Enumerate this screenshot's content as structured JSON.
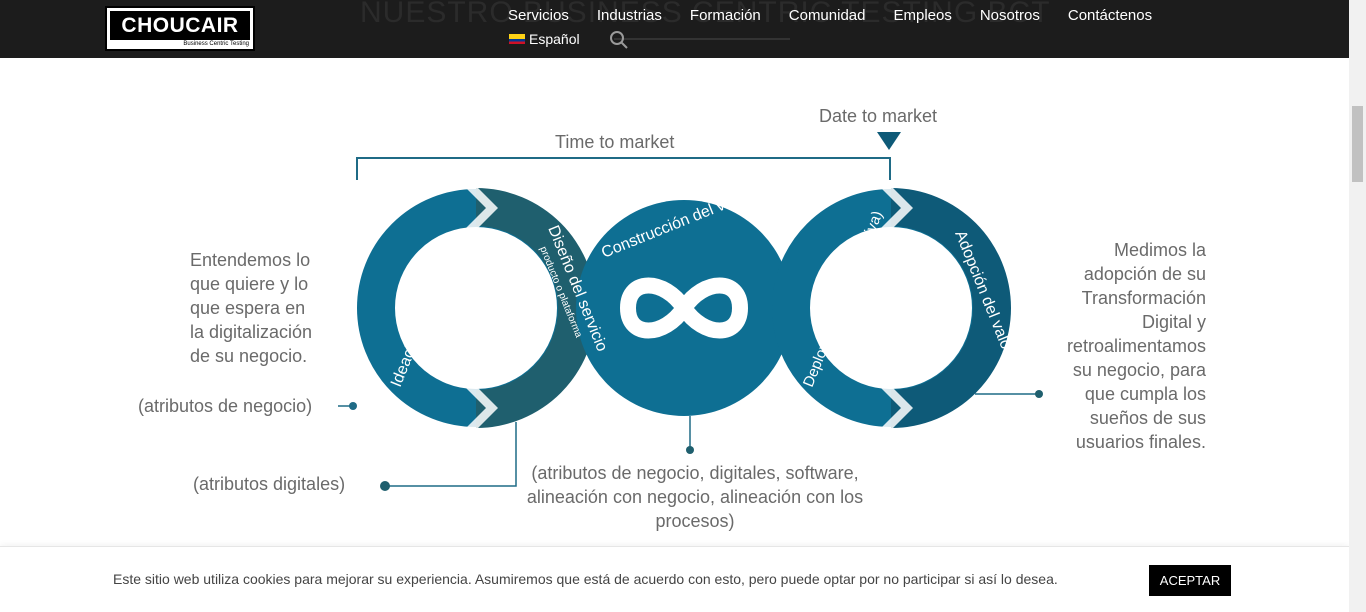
{
  "header": {
    "logo_text": "CHOUCAIR",
    "logo_sub": "Business Centric Testing",
    "background_heading": "NUESTRO BUSINESS CENTRIC TESTING BCT",
    "nav": [
      "Servicios",
      "Industrias",
      "Formación",
      "Comunidad",
      "Empleos",
      "Nosotros",
      "Contáctenos"
    ],
    "language": "Español"
  },
  "diagram": {
    "time_to_market": "Time to market",
    "date_to_market": "Date to market",
    "left_text": [
      "Entendemos lo",
      "que quiere y lo",
      "que espera en",
      "la digitalización",
      "de su negocio."
    ],
    "right_text": [
      "Medimos la",
      "adopción de su",
      "Transformación",
      "Digital y",
      "retroalimentamos",
      "su negocio, para",
      "que cumpla los",
      "sueños de sus",
      "usuarios finales."
    ],
    "attr_negocio": "(atributos de negocio)",
    "attr_digitales": "(atributos digitales)",
    "attr_bottom": "(atributos de negocio, digitales, software, alineación con negocio, alineación con los procesos)",
    "ring_labels": {
      "ideacion": "Ideación del negocio",
      "diseno": "Diseño del servicio",
      "diseno_sub": "producto o plataforma",
      "construccion": "Construcción del valor",
      "deployment": "Deployment valor (iniciativa)",
      "adopcion": "Adopción del valor"
    },
    "colors": {
      "blue_main": "#0e6f93",
      "teal_dark": "#1f5f6e",
      "blue_dark": "#0e5a78",
      "grey_text": "#6a6a6a",
      "line": "#1f6b86"
    }
  },
  "cookie": {
    "text": "Este sitio web utiliza cookies para mejorar su experiencia. Asumiremos que está de acuerdo con esto, pero puede optar por no participar si así lo desea.",
    "accept": "ACEPTAR"
  }
}
